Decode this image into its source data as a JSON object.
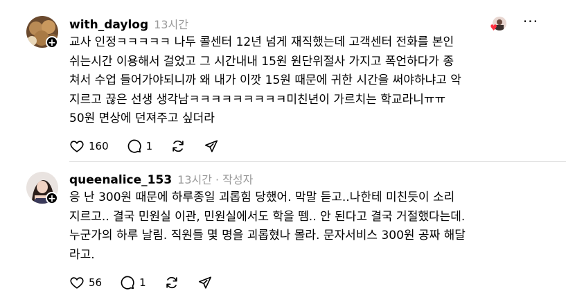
{
  "posts": [
    {
      "username": "with_daylog",
      "time": "13시간",
      "author_tag": "",
      "more_label": "···",
      "lines": [
        "교사 인정ㅋㅋㅋㅋㅋ 나두 콜센터 12년 넘게 재직했는데 고객센터 전화를 본인",
        "쉬는시간 이용해서 걸었고 그 시간내내 15원 원단위절사 가지고 폭언하다가 종",
        "쳐서 수업 들어가야되니까 왜 내가 이깟 15원 때문에 귀한 시간을 써야하냐고 악",
        "지르고 끊은 선생 생각남ㅋㅋㅋㅋㅋㅋㅋㅋㅋ미친년이 가르치는 학교라니ㅠㅠ",
        "50원 면상에 던져주고 싶더라"
      ],
      "likes": "160",
      "comments": "1",
      "icons": [
        "heart-icon",
        "comment-icon",
        "repost-icon",
        "share-icon"
      ]
    },
    {
      "username": "queenalice_153",
      "time": "13시간",
      "author_tag": "· 작성자",
      "more_label": "",
      "lines": [
        "응 난 300원 때문에 하루종일 괴롭힘 당했어. 막말 듣고..나한테 미친듯이 소리",
        "지르고.. 결국 민원실 이관, 민원실에서도 학을 뗌.. 안 된다고 결국 거절했다는데.",
        "누군가의 하루 날림. 직원들 몇 명을 괴롭혔나 몰라. 문자서비스 300원 공짜 해달",
        "라고."
      ],
      "likes": "56",
      "comments": "1",
      "icons": [
        "heart-icon",
        "comment-icon",
        "repost-icon",
        "share-icon"
      ]
    }
  ],
  "colors": {
    "muted": "#999999",
    "divider": "#dbdbdb",
    "liked_heart": "#ff3040"
  }
}
